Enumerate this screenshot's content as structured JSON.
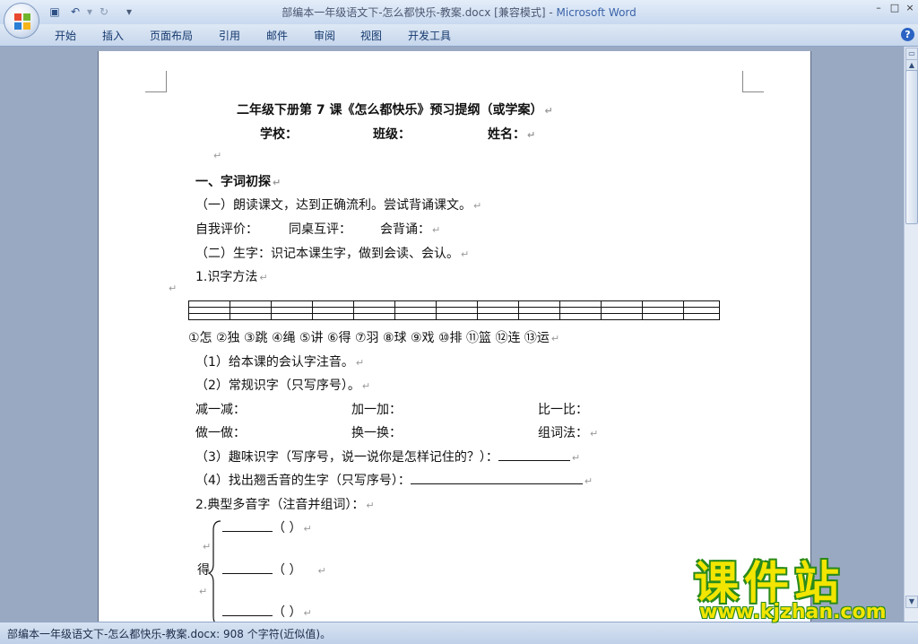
{
  "window": {
    "title_doc": "部编本一年级语文下-怎么都快乐-教案.docx [兼容模式] - ",
    "title_app": "Microsoft Word",
    "minimize": "–",
    "maximize": "□",
    "close": "×"
  },
  "quick_access": {
    "save_icon": "save-icon",
    "undo_icon": "undo-icon",
    "redo_icon": "redo-icon"
  },
  "ribbon": {
    "tabs": [
      "开始",
      "插入",
      "页面布局",
      "引用",
      "邮件",
      "审阅",
      "视图",
      "开发工具"
    ],
    "help": "?"
  },
  "document": {
    "title": "二年级下册第 7 课《怎么都快乐》预习提纲（或学案）",
    "info_school": "学校：",
    "info_class": "班级：",
    "info_name": "姓名：",
    "section1_heading": "一、字词初探",
    "task1": "（一）朗读课文，达到正确流利。尝试背诵课文。",
    "eval_self": "自我评价：",
    "eval_peer": "同桌互评：",
    "eval_recite": "会背诵：",
    "task2": "（二）生字：识记本课生字，做到会读、会认。",
    "method_heading": "1.识字方法",
    "chars": "①怎  ②独  ③跳  ④绳 ⑤讲  ⑥得  ⑦羽 ⑧球  ⑨戏  ⑩排  ⑪篮  ⑫连  ⑬运",
    "sub1": "（1）给本课的会认字注音。",
    "sub2": "（2）常规识字（只写序号）。",
    "method_a": "减一减：",
    "method_b": "加一加：",
    "method_c": "比一比：",
    "method_d": "做一做：",
    "method_e": "换一换：",
    "method_f": "组词法：",
    "sub3": "（3）趣味识字（写序号，说一说你是怎样记住的？）：",
    "sub4": "（4）找出翘舌音的生字（只写序号）：",
    "polyphone_heading": "2.典型多音字（注音并组词）：",
    "polyphone_char": "得",
    "blank_paren": "（          ）"
  },
  "statusbar": {
    "text": "部编本一年级语文下-怎么都快乐-教案.docx: 908 个字符(近似值)。"
  },
  "watermark": {
    "title": "课件站",
    "url": "www.kjzhan.com"
  }
}
